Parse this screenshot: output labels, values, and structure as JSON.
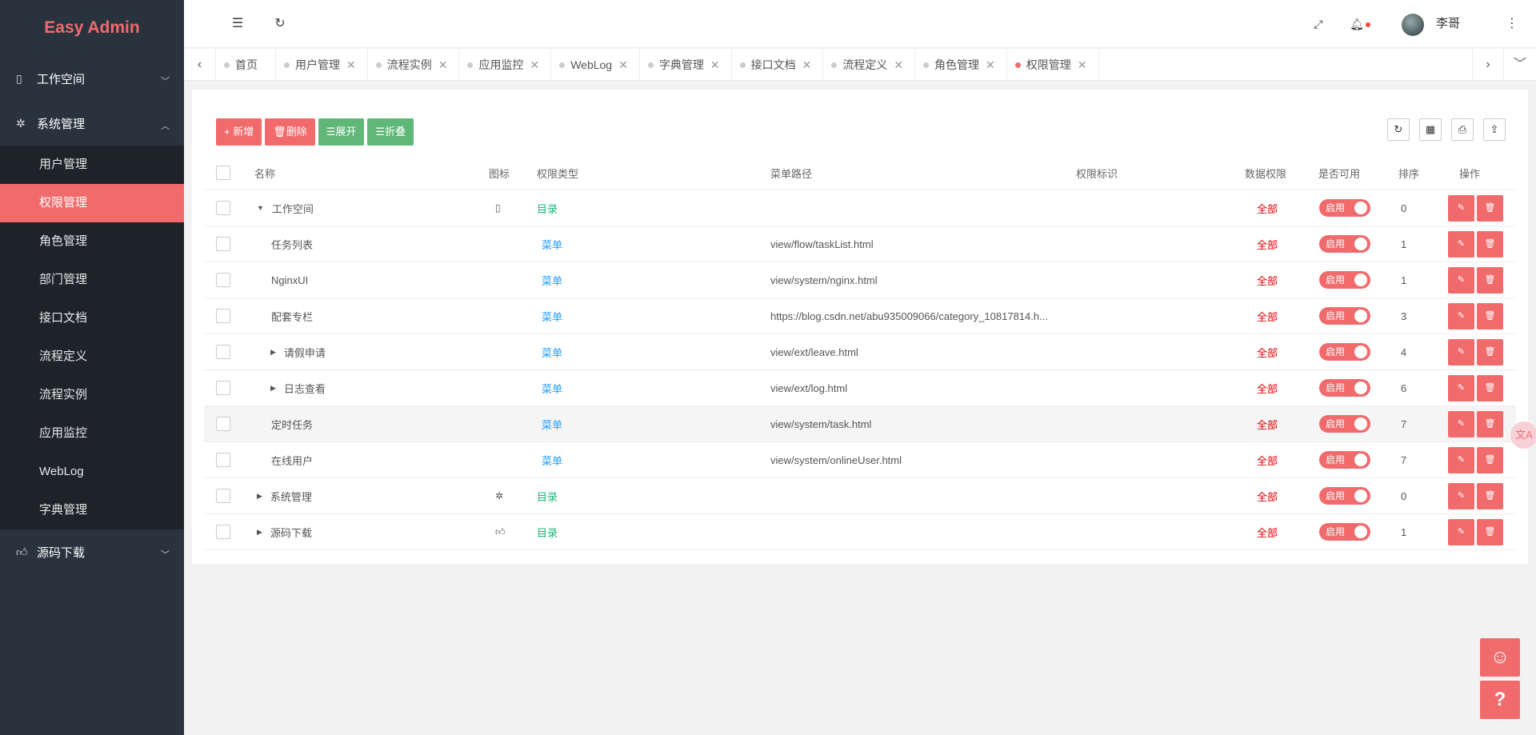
{
  "app": {
    "title": "Easy Admin"
  },
  "sidebar": {
    "groups": [
      {
        "label": "工作空间",
        "icon": "tablet-icon",
        "open": false
      },
      {
        "label": "系统管理",
        "icon": "gear-icon",
        "open": true,
        "items": [
          "用户管理",
          "权限管理",
          "角色管理",
          "部门管理",
          "接口文档",
          "流程定义",
          "流程实例",
          "应用监控",
          "WebLog",
          "字典管理"
        ],
        "active": "权限管理"
      },
      {
        "label": "源码下载",
        "icon": "thumbs-up-icon",
        "open": false
      }
    ]
  },
  "header": {
    "username": "李哥",
    "icons": [
      "menu-toggle-icon",
      "refresh-icon",
      "fullscreen-icon",
      "bell-icon",
      "more-icon"
    ]
  },
  "tabs": {
    "items": [
      "首页",
      "用户管理",
      "流程实例",
      "应用监控",
      "WebLog",
      "字典管理",
      "接口文档",
      "流程定义",
      "角色管理",
      "权限管理"
    ],
    "active": "权限管理"
  },
  "toolbar": {
    "add": "+ 新增",
    "delete": "删除",
    "expand": "展开",
    "collapse": "折叠"
  },
  "table": {
    "headers": {
      "name": "名称",
      "icon": "图标",
      "type": "权限类型",
      "path": "菜单路径",
      "mark": "权限标识",
      "data_perm": "数据权限",
      "enabled": "是否可用",
      "sort": "排序",
      "ops": "操作"
    },
    "rows": [
      {
        "name": "工作空间",
        "indent": 0,
        "tree": "expanded",
        "icon": "tablet-icon",
        "type": "目录",
        "path": "",
        "mark": "",
        "data_perm": "全部",
        "enabled": "启用",
        "sort": "0"
      },
      {
        "name": "任务列表",
        "indent": 1,
        "tree": "none",
        "icon": "",
        "type": "菜单",
        "path": "view/flow/taskList.html",
        "mark": "",
        "data_perm": "全部",
        "enabled": "启用",
        "sort": "1"
      },
      {
        "name": "NginxUI",
        "indent": 1,
        "tree": "none",
        "icon": "",
        "type": "菜单",
        "path": "view/system/nginx.html",
        "mark": "",
        "data_perm": "全部",
        "enabled": "启用",
        "sort": "1"
      },
      {
        "name": "配套专栏",
        "indent": 1,
        "tree": "none",
        "icon": "",
        "type": "菜单",
        "path": "https://blog.csdn.net/abu935009066/category_10817814.h...",
        "mark": "",
        "data_perm": "全部",
        "enabled": "启用",
        "sort": "3"
      },
      {
        "name": "请假申请",
        "indent": 1,
        "tree": "collapsed",
        "icon": "",
        "type": "菜单",
        "path": "view/ext/leave.html",
        "mark": "",
        "data_perm": "全部",
        "enabled": "启用",
        "sort": "4"
      },
      {
        "name": "日志查看",
        "indent": 1,
        "tree": "collapsed",
        "icon": "",
        "type": "菜单",
        "path": "view/ext/log.html",
        "mark": "",
        "data_perm": "全部",
        "enabled": "启用",
        "sort": "6"
      },
      {
        "name": "定时任务",
        "indent": 1,
        "tree": "none",
        "icon": "",
        "type": "菜单",
        "path": "view/system/task.html",
        "mark": "",
        "data_perm": "全部",
        "enabled": "启用",
        "sort": "7"
      },
      {
        "name": "在线用户",
        "indent": 1,
        "tree": "none",
        "icon": "",
        "type": "菜单",
        "path": "view/system/onlineUser.html",
        "mark": "",
        "data_perm": "全部",
        "enabled": "启用",
        "sort": "7"
      },
      {
        "name": "系统管理",
        "indent": 0,
        "tree": "collapsed",
        "icon": "gear-icon",
        "type": "目录",
        "path": "",
        "mark": "",
        "data_perm": "全部",
        "enabled": "启用",
        "sort": "0"
      },
      {
        "name": "源码下载",
        "indent": 0,
        "tree": "collapsed",
        "icon": "thumbs-up-icon",
        "type": "目录",
        "path": "",
        "mark": "",
        "data_perm": "全部",
        "enabled": "启用",
        "sort": "1"
      }
    ]
  },
  "colors": {
    "accent": "#f16b6c",
    "sidebar": "#28333e",
    "submenu": "#1d2329",
    "green": "#5fb878",
    "dir": "#16b777",
    "menu": "#1e9fff"
  }
}
